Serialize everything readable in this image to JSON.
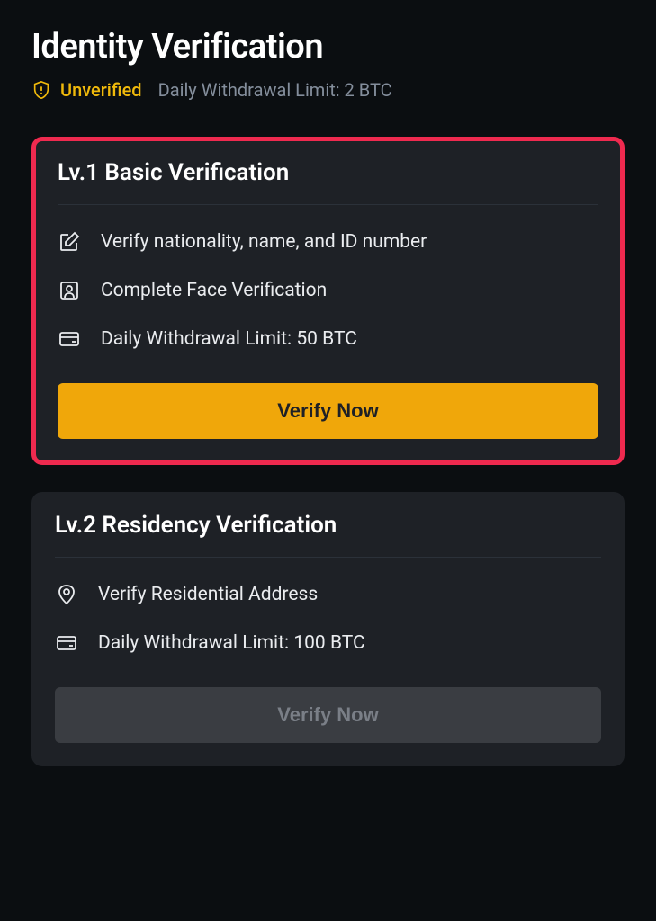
{
  "header": {
    "title": "Identity Verification",
    "status": "Unverified",
    "limit": "Daily Withdrawal Limit: 2 BTC"
  },
  "card1": {
    "title": "Lv.1 Basic Verification",
    "item1": "Verify nationality, name, and ID number",
    "item2": "Complete Face Verification",
    "item3": "Daily Withdrawal Limit: 50 BTC",
    "button": "Verify Now"
  },
  "card2": {
    "title": "Lv.2 Residency Verification",
    "item1": "Verify Residential Address",
    "item2": "Daily Withdrawal Limit: 100 BTC",
    "button": "Verify Now"
  }
}
